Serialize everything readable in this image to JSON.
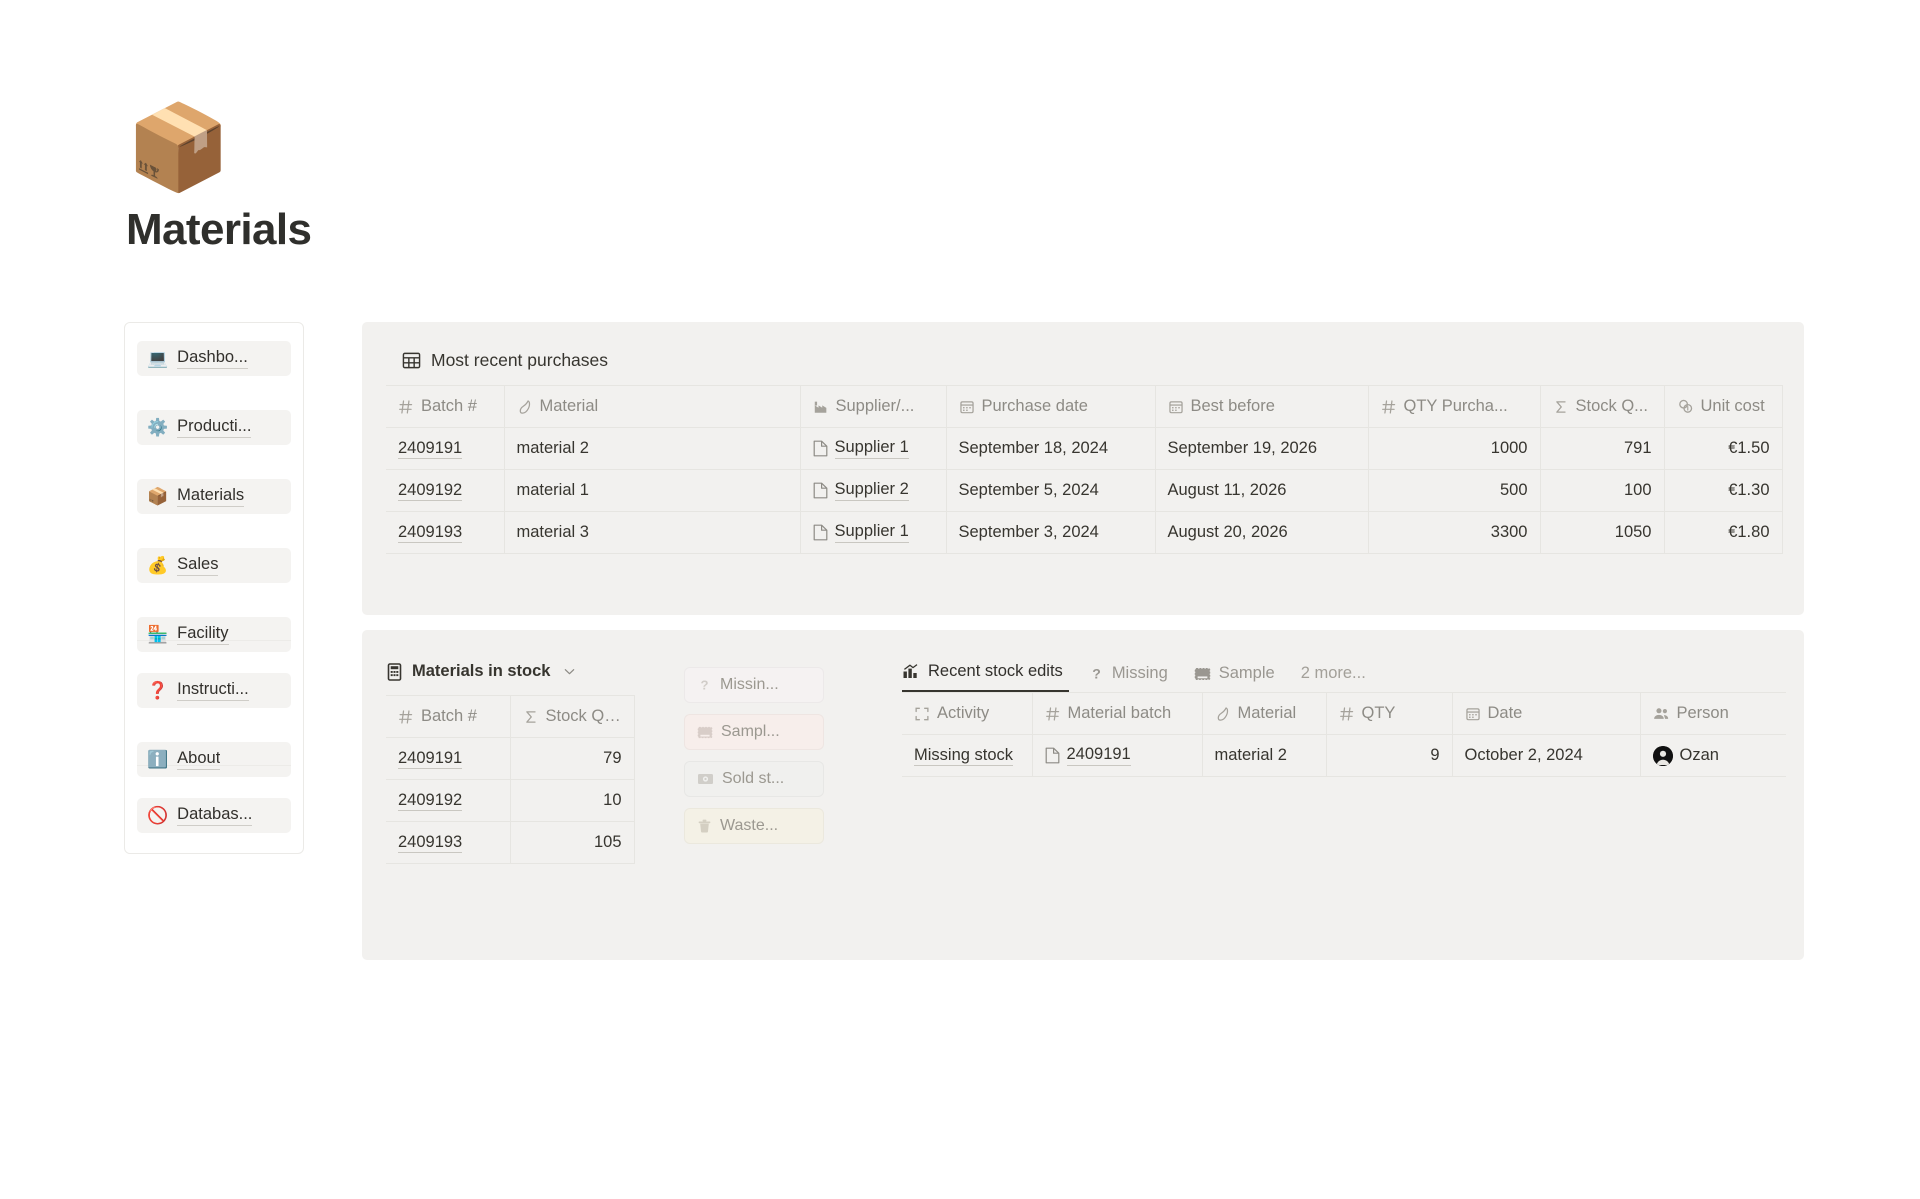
{
  "header": {
    "emoji": "📦",
    "title": "Materials"
  },
  "sidebar": {
    "items": [
      {
        "icon": "laptop-icon",
        "emoji": "💻",
        "label": "Dashbo..."
      },
      {
        "icon": "gear-icon",
        "emoji": "⚙️",
        "label": "Producti..."
      },
      {
        "icon": "package-icon",
        "emoji": "📦",
        "label": "Materials"
      },
      {
        "icon": "moneybag-icon",
        "emoji": "💰",
        "label": "Sales"
      },
      {
        "icon": "factory-icon",
        "emoji": "🏪",
        "label": "Facility"
      },
      {
        "icon": "question-icon",
        "emoji": "❓",
        "label": "Instructi..."
      },
      {
        "icon": "info-icon",
        "emoji": "ℹ️",
        "label": "About"
      },
      {
        "icon": "forbidden-icon",
        "emoji": "🚫",
        "label": "Databas..."
      }
    ]
  },
  "purchases": {
    "title": "Most recent purchases",
    "title_icon": "table-icon",
    "columns": [
      {
        "label": "Batch #",
        "icon": "hash-icon",
        "align": "left"
      },
      {
        "label": "Material",
        "icon": "relation-icon",
        "align": "left"
      },
      {
        "label": "Supplier/...",
        "icon": "factory-icon",
        "align": "left"
      },
      {
        "label": "Purchase date",
        "icon": "calendar-icon",
        "align": "left"
      },
      {
        "label": "Best before",
        "icon": "calendar-icon",
        "align": "left"
      },
      {
        "label": "QTY Purcha...",
        "icon": "hash-icon",
        "align": "right"
      },
      {
        "label": "Stock Q...",
        "icon": "sigma-icon",
        "align": "right"
      },
      {
        "label": "Unit cost",
        "icon": "rollup-icon",
        "align": "right"
      }
    ],
    "rows": [
      {
        "batch": "2409191",
        "material": "material 2",
        "supplier": "Supplier 1",
        "purchase_date": "September 18, 2024",
        "best_before": "September 19, 2026",
        "qty_purchased": "1000",
        "stock_qty": "791",
        "unit_cost": "€1.50"
      },
      {
        "batch": "2409192",
        "material": "material 1",
        "supplier": "Supplier 2",
        "purchase_date": "September 5, 2024",
        "best_before": "August 11, 2026",
        "qty_purchased": "500",
        "stock_qty": "100",
        "unit_cost": "€1.30"
      },
      {
        "batch": "2409193",
        "material": "material 3",
        "supplier": "Supplier 1",
        "purchase_date": "September 3, 2024",
        "best_before": "August 20, 2026",
        "qty_purchased": "3300",
        "stock_qty": "1050",
        "unit_cost": "€1.80"
      }
    ]
  },
  "stock": {
    "title": "Materials in stock",
    "title_icon": "database-icon",
    "chevron": "chevron-down-icon",
    "columns": [
      {
        "label": "Batch #",
        "icon": "hash-icon",
        "align": "left"
      },
      {
        "label": "Stock QTY",
        "icon": "sigma-icon",
        "align": "right"
      }
    ],
    "rows": [
      {
        "batch": "2409191",
        "qty": "79"
      },
      {
        "batch": "2409192",
        "qty": "10"
      },
      {
        "batch": "2409193",
        "qty": "105"
      }
    ]
  },
  "actions": [
    {
      "label": "Missin...",
      "icon": "question-icon",
      "bg": "#f5f2f2"
    },
    {
      "label": "Sampl...",
      "icon": "ticket-icon",
      "bg": "#f7eeeb"
    },
    {
      "label": "Sold st...",
      "icon": "money-icon",
      "bg": "#f0f0ee"
    },
    {
      "label": "Waste...",
      "icon": "trash-icon",
      "bg": "#f4f1e6"
    }
  ],
  "edits": {
    "tabs": [
      {
        "label": "Recent stock edits",
        "icon": "chart-icon",
        "active": true
      },
      {
        "label": "Missing",
        "icon": "question-icon",
        "active": false
      },
      {
        "label": "Sample",
        "icon": "ticket-icon",
        "active": false
      },
      {
        "label": "2 more...",
        "icon": "",
        "active": false
      }
    ],
    "columns": [
      {
        "label": "Activity",
        "icon": "expand-icon",
        "align": "left"
      },
      {
        "label": "Material batch",
        "icon": "hash-icon",
        "align": "left"
      },
      {
        "label": "Material",
        "icon": "relation-icon",
        "align": "left"
      },
      {
        "label": "QTY",
        "icon": "hash-icon",
        "align": "right"
      },
      {
        "label": "Date",
        "icon": "calendar-icon",
        "align": "left"
      },
      {
        "label": "Person",
        "icon": "people-icon",
        "align": "left"
      }
    ],
    "rows": [
      {
        "activity": "Missing stock",
        "material_batch": "2409191",
        "material": "material 2",
        "qty": "9",
        "date": "October 2, 2024",
        "person": "Ozan"
      }
    ]
  },
  "colors": {
    "card_bg": "#f2f1ef",
    "page_bg": "#ffffff",
    "text": "#37352f",
    "muted": "#8d8b85",
    "border": "#e6e5e1"
  }
}
